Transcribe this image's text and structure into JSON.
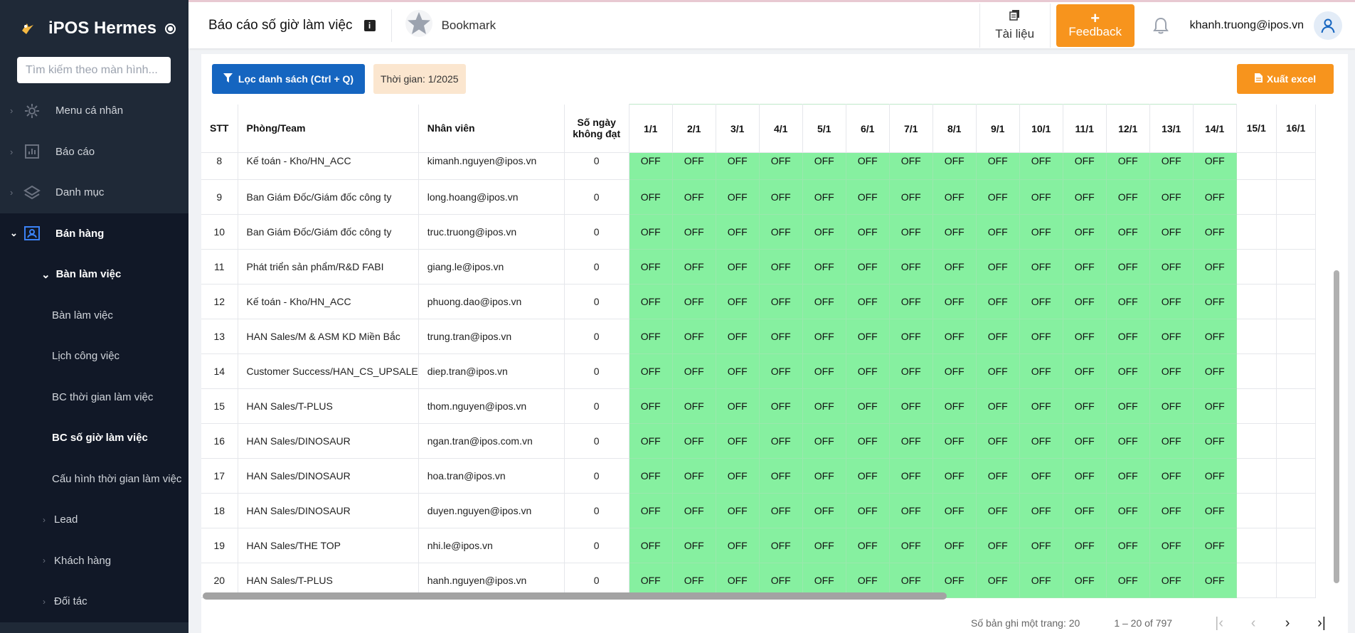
{
  "app": {
    "name": "iPOS Hermes"
  },
  "sidebar": {
    "search_placeholder": "Tìm kiếm theo màn hình...",
    "items": [
      {
        "label": "Menu cá nhân",
        "icon": "gear-icon"
      },
      {
        "label": "Báo cáo",
        "icon": "chart-icon"
      },
      {
        "label": "Danh mục",
        "icon": "layers-icon"
      },
      {
        "label": "Bán hàng",
        "icon": "user-card-icon"
      }
    ],
    "sub_group": "Bàn làm việc",
    "sub_items": [
      {
        "label": "Bàn làm việc"
      },
      {
        "label": "Lịch công việc"
      },
      {
        "label": "BC thời gian làm việc"
      },
      {
        "label": "BC số giờ làm việc"
      },
      {
        "label": "Cấu hình thời gian làm việc"
      }
    ],
    "groups": [
      {
        "label": "Lead"
      },
      {
        "label": "Khách hàng"
      },
      {
        "label": "Đối tác"
      }
    ]
  },
  "header": {
    "title": "Báo cáo số giờ làm việc",
    "bookmark": "Bookmark",
    "docs": "Tài liệu",
    "feedback_plus": "+",
    "feedback": "Feedback",
    "user_email": "khanh.truong@ipos.vn"
  },
  "toolbar": {
    "filter": "Lọc danh sách (Ctrl + Q)",
    "time": "Thời gian: 1/2025",
    "excel": "Xuất excel"
  },
  "table": {
    "columns": [
      "STT",
      "Phòng/Team",
      "Nhân viên",
      "Số ngày\nkhông đạt",
      "1/1",
      "2/1",
      "3/1",
      "4/1",
      "5/1",
      "6/1",
      "7/1",
      "8/1",
      "9/1",
      "10/1",
      "11/1",
      "12/1",
      "13/1",
      "14/1",
      "15/1",
      "16/1"
    ],
    "off_label": "OFF",
    "rows": [
      {
        "stt": "8",
        "team": "Kế toán - Kho/HN_ACC",
        "employee": "kimanh.nguyen@ipos.vn",
        "missed": "0"
      },
      {
        "stt": "9",
        "team": "Ban Giám Đốc/Giám đốc công ty",
        "employee": "long.hoang@ipos.vn",
        "missed": "0"
      },
      {
        "stt": "10",
        "team": "Ban Giám Đốc/Giám đốc công ty",
        "employee": "truc.truong@ipos.vn",
        "missed": "0"
      },
      {
        "stt": "11",
        "team": "Phát triển sản phẩm/R&D FABI",
        "employee": "giang.le@ipos.vn",
        "missed": "0"
      },
      {
        "stt": "12",
        "team": "Kế toán - Kho/HN_ACC",
        "employee": "phuong.dao@ipos.vn",
        "missed": "0"
      },
      {
        "stt": "13",
        "team": "HAN Sales/M & ASM KD Miền Bắc",
        "employee": "trung.tran@ipos.vn",
        "missed": "0"
      },
      {
        "stt": "14",
        "team": "Customer Success/HAN_CS_UPSALE",
        "employee": "diep.tran@ipos.vn",
        "missed": "0"
      },
      {
        "stt": "15",
        "team": "HAN Sales/T-PLUS",
        "employee": "thom.nguyen@ipos.vn",
        "missed": "0"
      },
      {
        "stt": "16",
        "team": "HAN Sales/DINOSAUR",
        "employee": "ngan.tran@ipos.com.vn",
        "missed": "0"
      },
      {
        "stt": "17",
        "team": "HAN Sales/DINOSAUR",
        "employee": "hoa.tran@ipos.vn",
        "missed": "0"
      },
      {
        "stt": "18",
        "team": "HAN Sales/DINOSAUR",
        "employee": "duyen.nguyen@ipos.vn",
        "missed": "0"
      },
      {
        "stt": "19",
        "team": "HAN Sales/THE TOP",
        "employee": "nhi.le@ipos.vn",
        "missed": "0"
      },
      {
        "stt": "20",
        "team": "HAN Sales/T-PLUS",
        "employee": "hanh.nguyen@ipos.vn",
        "missed": "0"
      }
    ]
  },
  "pager": {
    "per_page": "Số bản ghi một trang: 20",
    "range": "1 – 20 of 797"
  },
  "colors": {
    "sidebar_bg": "#1f2937",
    "primary": "#1565c0",
    "accent": "#f7941d",
    "off_cell": "#86f0a0"
  }
}
